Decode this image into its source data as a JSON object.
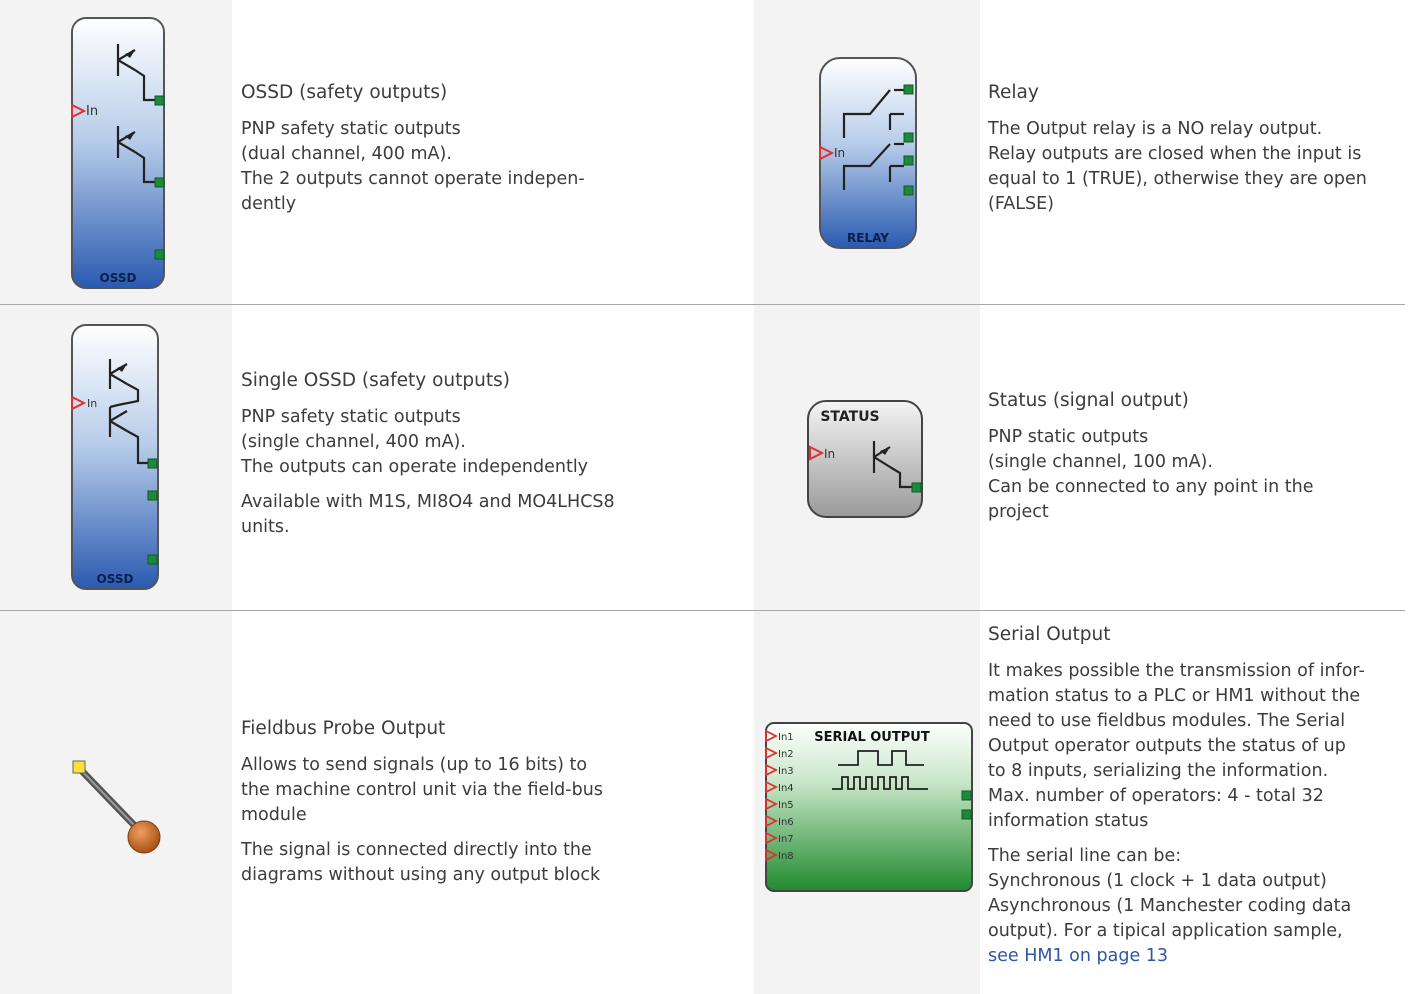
{
  "rows": [
    {
      "left": {
        "block_label": "OSSD",
        "input_label": "In",
        "title": "OSSD (safety outputs)",
        "lines": [
          "PNP safety static outputs",
          "(dual channel, 400 mA).",
          "The 2 outputs cannot operate indepen-",
          "dently"
        ],
        "extra": []
      },
      "right": {
        "block_label": "RELAY",
        "input_label": "In",
        "title": "Relay",
        "lines": [
          "The Output relay is a NO relay output.",
          "Relay outputs are closed when the input is",
          "equal to 1 (TRUE), otherwise they are open",
          "(FALSE)"
        ]
      }
    },
    {
      "left": {
        "block_label": "OSSD",
        "input_label": "In",
        "title": "Single OSSD (safety outputs)",
        "lines": [
          "PNP safety static outputs",
          "(single channel, 400 mA).",
          "The outputs can operate independently"
        ],
        "extra": [
          "Available with M1S, MI8O4 and MO4LHCS8",
          "units."
        ]
      },
      "right": {
        "block_label": "STATUS",
        "input_label": "In",
        "title": "Status (signal output)",
        "lines": [
          "PNP static outputs",
          "(single channel, 100 mA).",
          "Can be connected to any point in the",
          "project"
        ]
      }
    },
    {
      "left": {
        "title": "Fieldbus Probe Output",
        "lines": [
          "Allows to send signals (up to 16 bits) to",
          "the machine control unit via the field-bus",
          "module"
        ],
        "extra": [
          "The signal is connected directly into the",
          "diagrams without using any output block"
        ]
      },
      "right": {
        "block_label": "SERIAL OUTPUT",
        "inputs": [
          "In1",
          "In2",
          "In3",
          "In4",
          "In5",
          "In6",
          "In7",
          "In8"
        ],
        "title": "Serial Output",
        "lines": [
          "It makes possible the transmission of infor-",
          "mation status to a PLC or HM1 without the",
          "need to use fieldbus modules. The Serial",
          "Output operator outputs the status of up",
          "to 8 inputs, serializing the information.",
          "Max. number of operators: 4 - total 32",
          "information status"
        ],
        "extra": [
          "The serial line can be:",
          "Synchronous  (1 clock + 1 data output)",
          "Asynchronous (1 Manchester coding data",
          "output). For a tipical application sample,"
        ],
        "link": "see HM1 on page 13"
      }
    }
  ]
}
